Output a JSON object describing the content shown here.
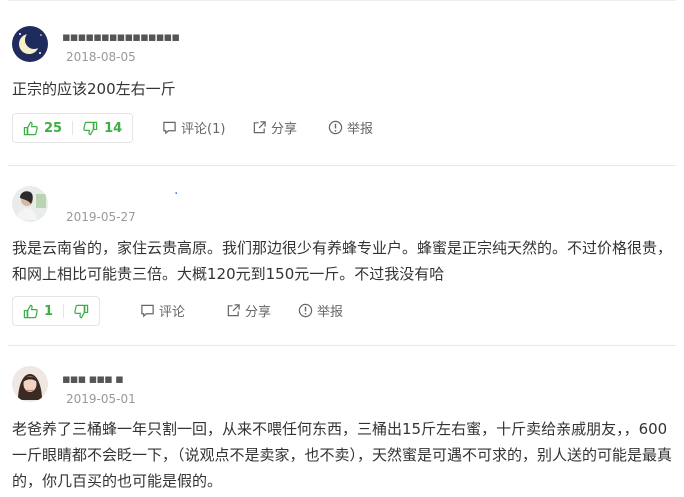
{
  "comments": [
    {
      "username": "▪▪▪▪▪▪▪▪▪▪▪▪▪▪▪",
      "date": "2018-08-05",
      "text": "正宗的应该200左右一斤",
      "likes": "25",
      "dislikes": "14",
      "comment_label": "评论(1)",
      "share_label": "分享",
      "report_label": "举报"
    },
    {
      "username": "·",
      "date": "2019-05-27",
      "text": "我是云南省的，家住云贵高原。我们那边很少有养蜂专业户。蜂蜜是正宗纯天然的。不过价格很贵，和网上相比可能贵三倍。大概120元到150元一斤。不过我没有哈",
      "likes": "1",
      "dislikes": "",
      "comment_label": "评论",
      "share_label": "分享",
      "report_label": "举报"
    },
    {
      "username": "▪▪▪ ▪▪▪ ▪",
      "date": "2019-05-01",
      "text": "老爸养了三桶蜂一年只割一回，从来不喂任何东西，三桶出15斤左右蜜，十斤卖给亲戚朋友，，600一斤眼睛都不会眨一下，（说观点不是卖家，也不卖），天然蜜是可遇不可求的，别人送的可能是最真的，你几百买的也可能是假的。"
    }
  ],
  "icons": {
    "like": "thumbs-up-icon",
    "dislike": "thumbs-down-icon",
    "comment": "comment-icon",
    "share": "share-icon",
    "report": "report-icon"
  },
  "colors": {
    "vote_green": "#3daf45",
    "date_gray": "#999999",
    "text": "#333333"
  }
}
